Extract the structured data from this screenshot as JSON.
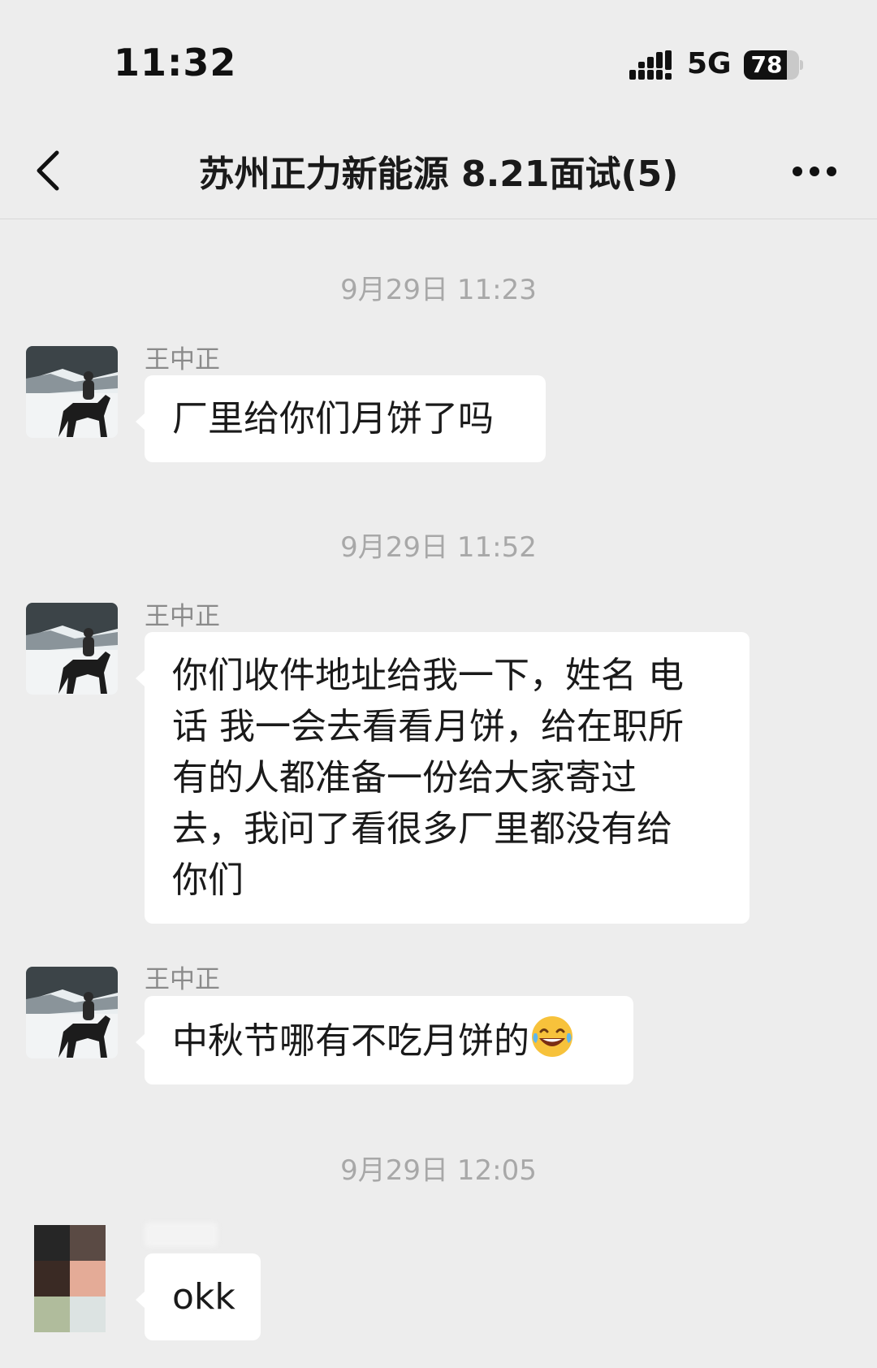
{
  "status_bar": {
    "time": "11:32",
    "network": "5G",
    "battery_level": "78",
    "battery_fraction": 0.78
  },
  "nav": {
    "title": "苏州正力新能源 8.21面试(5)",
    "back_icon": "chevron-left-icon",
    "more_icon": "more-dots-icon"
  },
  "chat": {
    "timestamps": [
      "9月29日 11:23",
      "9月29日 11:52",
      "9月29日 12:05"
    ],
    "messages": [
      {
        "sender": "王中正",
        "text": "厂里给你们月饼了吗"
      },
      {
        "sender": "王中正",
        "lines": [
          "你们收件地址给我一下，姓名 电",
          "话 我一会去看看月饼，给在职所",
          "有的人都准备一份给大家寄过",
          "去，我问了看很多厂里都没有给",
          "你们"
        ]
      },
      {
        "sender": "王中正",
        "text": "中秋节哪有不吃月饼的",
        "emoji": "laughing-tears-emoji"
      },
      {
        "sender": "",
        "text": "okk"
      }
    ]
  },
  "colors": {
    "background": "#ededed",
    "bubble": "#ffffff",
    "timestamp_text": "#a8a8a8",
    "sender_text": "#8a8a8a",
    "emoji_face": "#f7c23b"
  }
}
